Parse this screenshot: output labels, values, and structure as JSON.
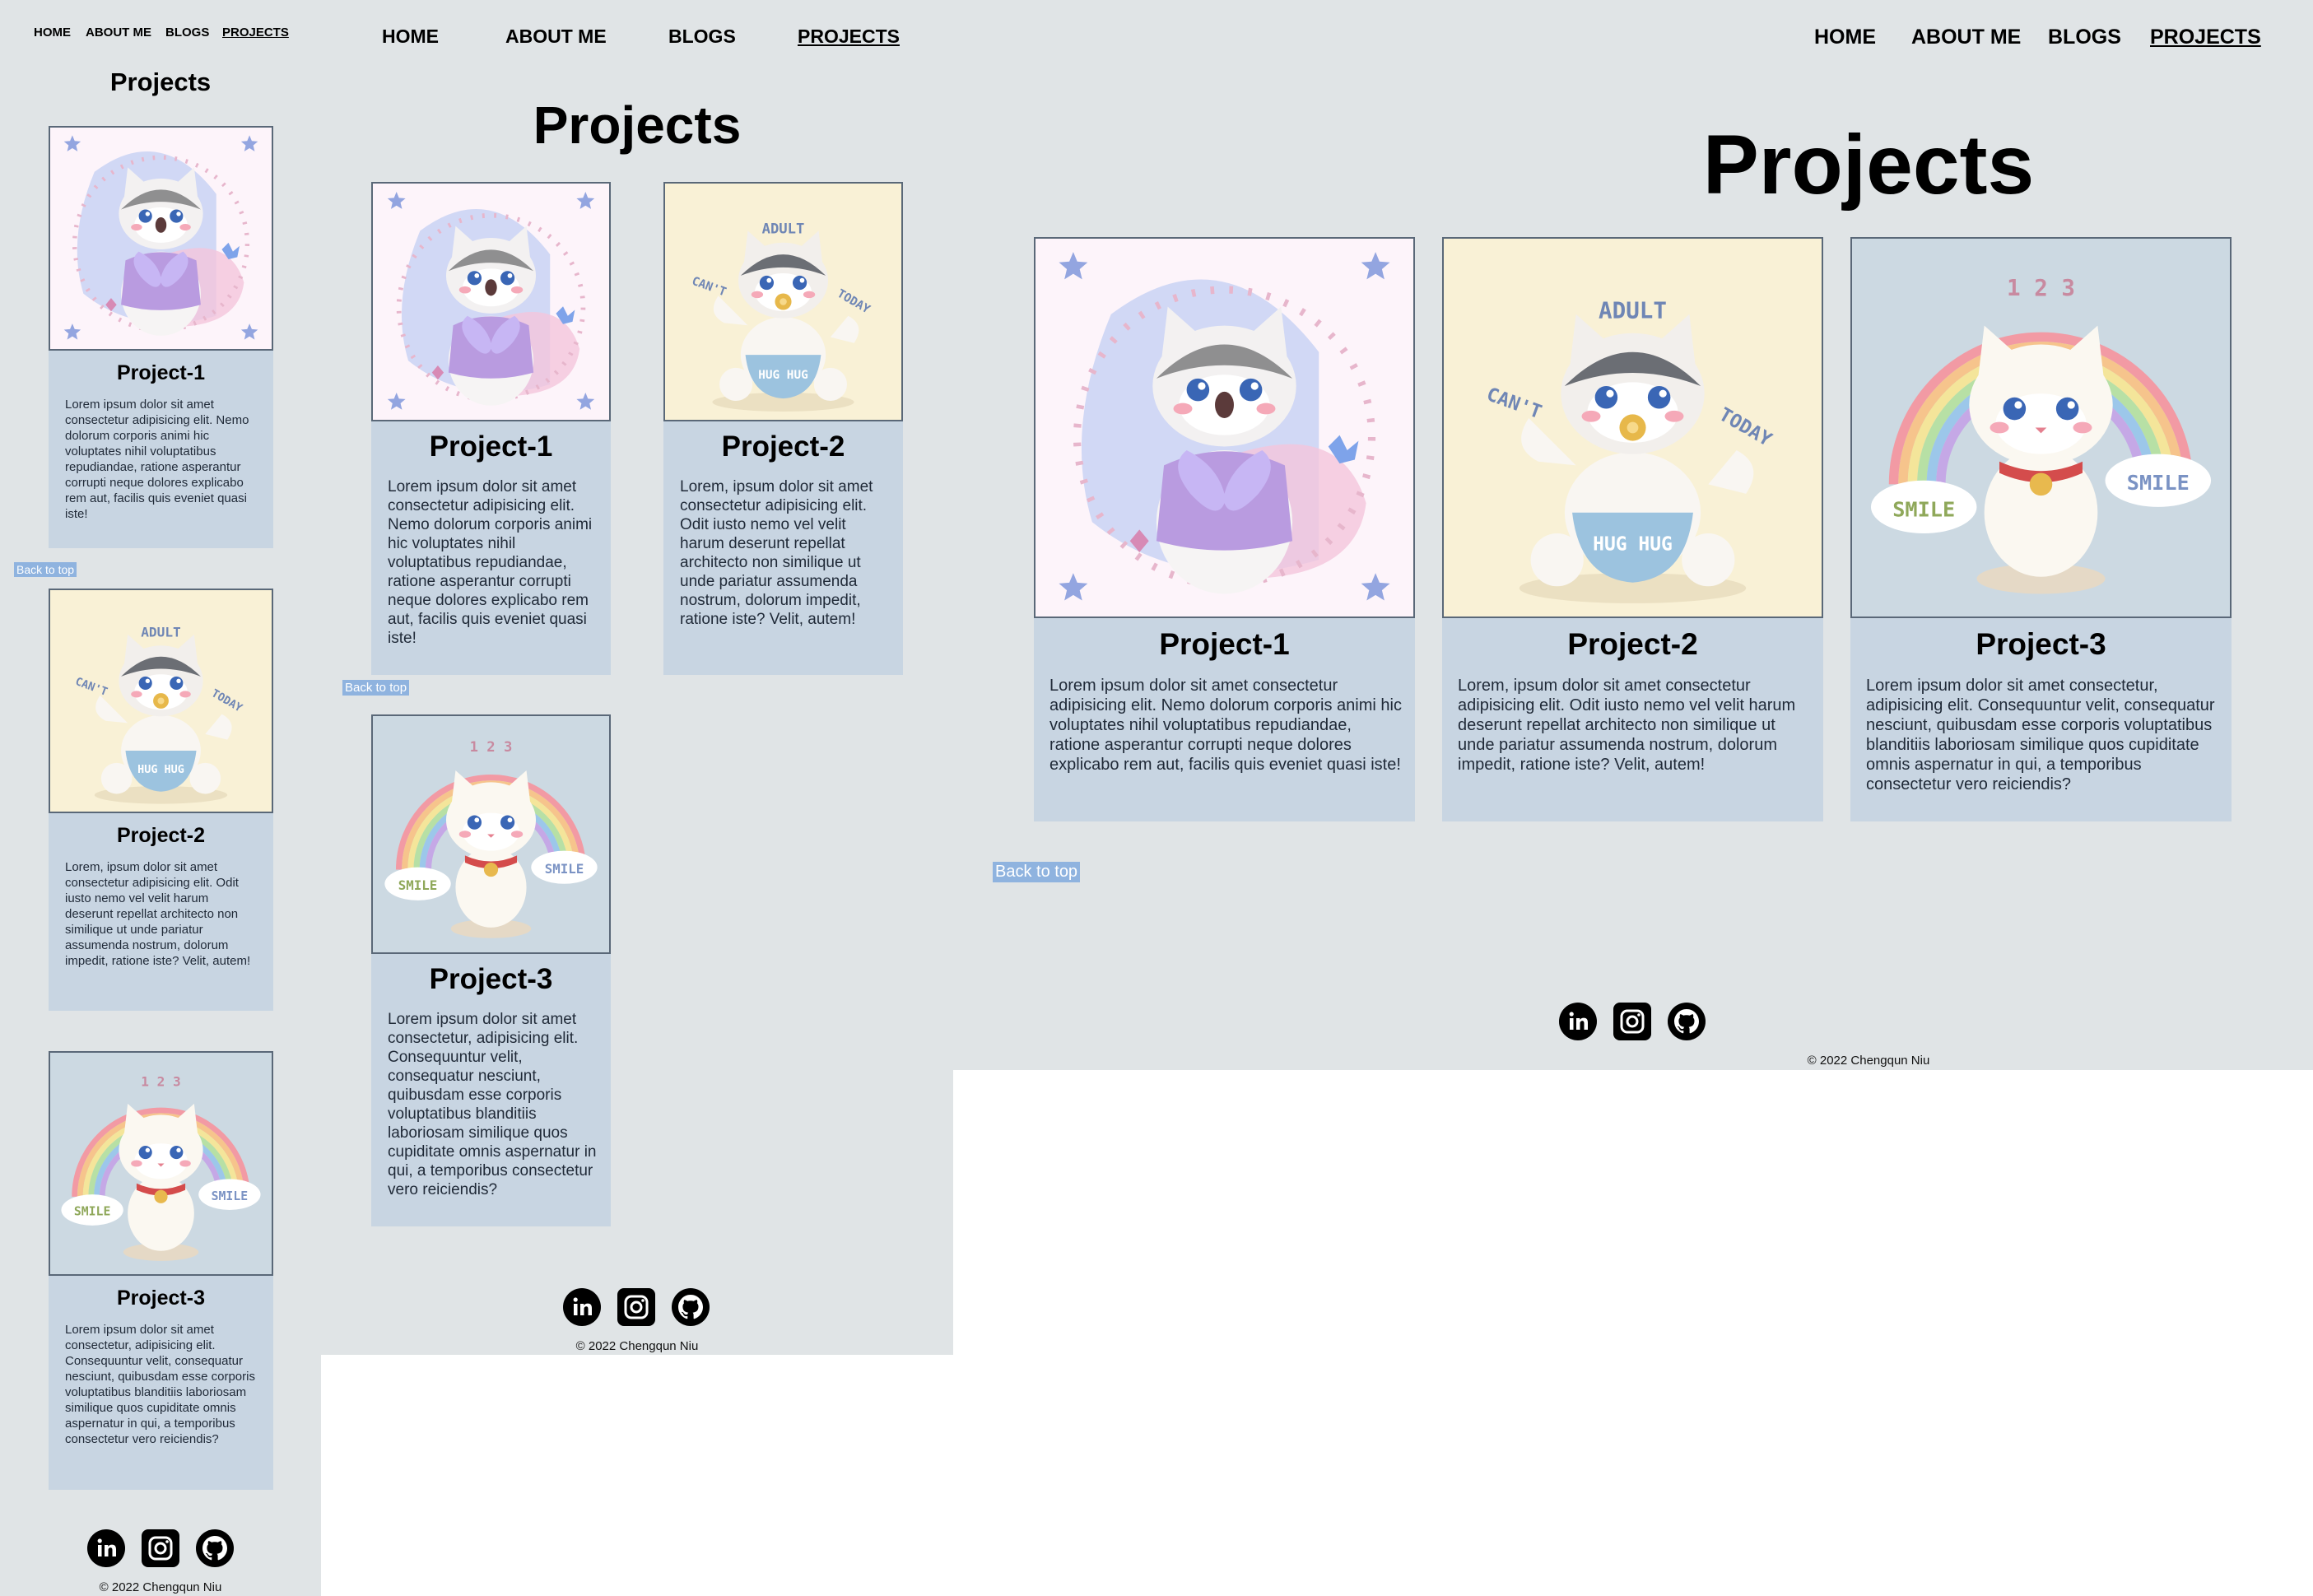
{
  "nav": {
    "home": "HOME",
    "about": "ABOUT ME",
    "blogs": "BLOGS",
    "projects": "PROJECTS"
  },
  "page_title": "Projects",
  "projects": [
    {
      "title": "Project-1",
      "description": "Lorem ipsum dolor sit amet consectetur adipisicing elit. Nemo dolorum corporis animi hic voluptates nihil voluptatibus repudiandae, ratione asperantur corrupti neque dolores explicabo rem aut, facilis quis eveniet quasi iste!",
      "art": "cat-with-butterfly-bow",
      "bg": "#fdf4fa"
    },
    {
      "title": "Project-2",
      "description": "Lorem, ipsum dolor sit amet consectetur adipisicing elit. Odit iusto nemo vel velit harum deserunt repellat architecto non similique ut unde pariatur assumenda nostrum, dolorum impedit, ratione iste? Velit, autem!",
      "art": "cat-with-pacifier",
      "bg": "#f9f1d6",
      "art_text": {
        "top": "ADULT",
        "left": "CAN'T",
        "right": "TODAY",
        "bowl": "HUG HUG"
      }
    },
    {
      "title": "Project-3",
      "description": "Lorem ipsum dolor sit amet consectetur, adipisicing elit. Consequuntur velit, consequatur nesciunt, quibusdam esse corporis voluptatibus blanditiis laboriosam similique quos cupiditate omnis aspernatur in qui, a temporibus consectetur vero reiciendis?",
      "art": "white-cat-rainbow",
      "bg": "#ccd9e2",
      "art_text": {
        "top": "1 2 3",
        "cloud_left": "SMILE",
        "cloud_right": "SMILE"
      }
    }
  ],
  "back_to_top": "Back to top",
  "social": [
    "linkedin-icon",
    "instagram-icon",
    "github-icon"
  ],
  "copyright": "© 2022 Chengqun Niu",
  "colors": {
    "page_bg": "#e0e4e6",
    "card_bg": "#c8d5e2",
    "back_to_top_bg": "#8fb3df"
  }
}
